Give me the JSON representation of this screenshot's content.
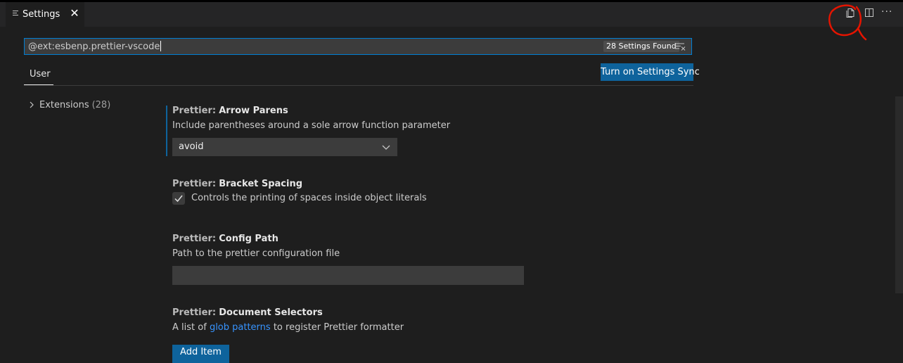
{
  "tab": {
    "label": "Settings",
    "close_glyph": "✕"
  },
  "actions": {
    "open_json_icon": "open-settings-json-icon",
    "split_icon": "split-editor-icon",
    "more_glyph": "···"
  },
  "search": {
    "value": "@ext:esbenp.prettier-vscode",
    "results_badge": "28 Settings Found"
  },
  "scope_tab": {
    "label": "User"
  },
  "sync_button": {
    "label": "Turn on Settings Sync"
  },
  "tree": {
    "label": "Extensions",
    "count": "(28)"
  },
  "settings": [
    {
      "category": "Prettier:",
      "name": "Arrow Parens",
      "description": "Include parentheses around a sole arrow function parameter",
      "value": "avoid"
    },
    {
      "category": "Prettier:",
      "name": "Bracket Spacing",
      "description": "Controls the printing of spaces inside object literals",
      "checked": true
    },
    {
      "category": "Prettier:",
      "name": "Config Path",
      "description": "Path to the prettier configuration file",
      "value": ""
    },
    {
      "category": "Prettier:",
      "name": "Document Selectors",
      "description_before": "A list of",
      "link_text": "glob patterns",
      "description_after": "to register Prettier formatter",
      "button_label": "Add Item"
    }
  ],
  "colors": {
    "accent": "#0e639c",
    "focus_border": "#007fd4",
    "link": "#3794ff",
    "annotation": "#e51400"
  }
}
